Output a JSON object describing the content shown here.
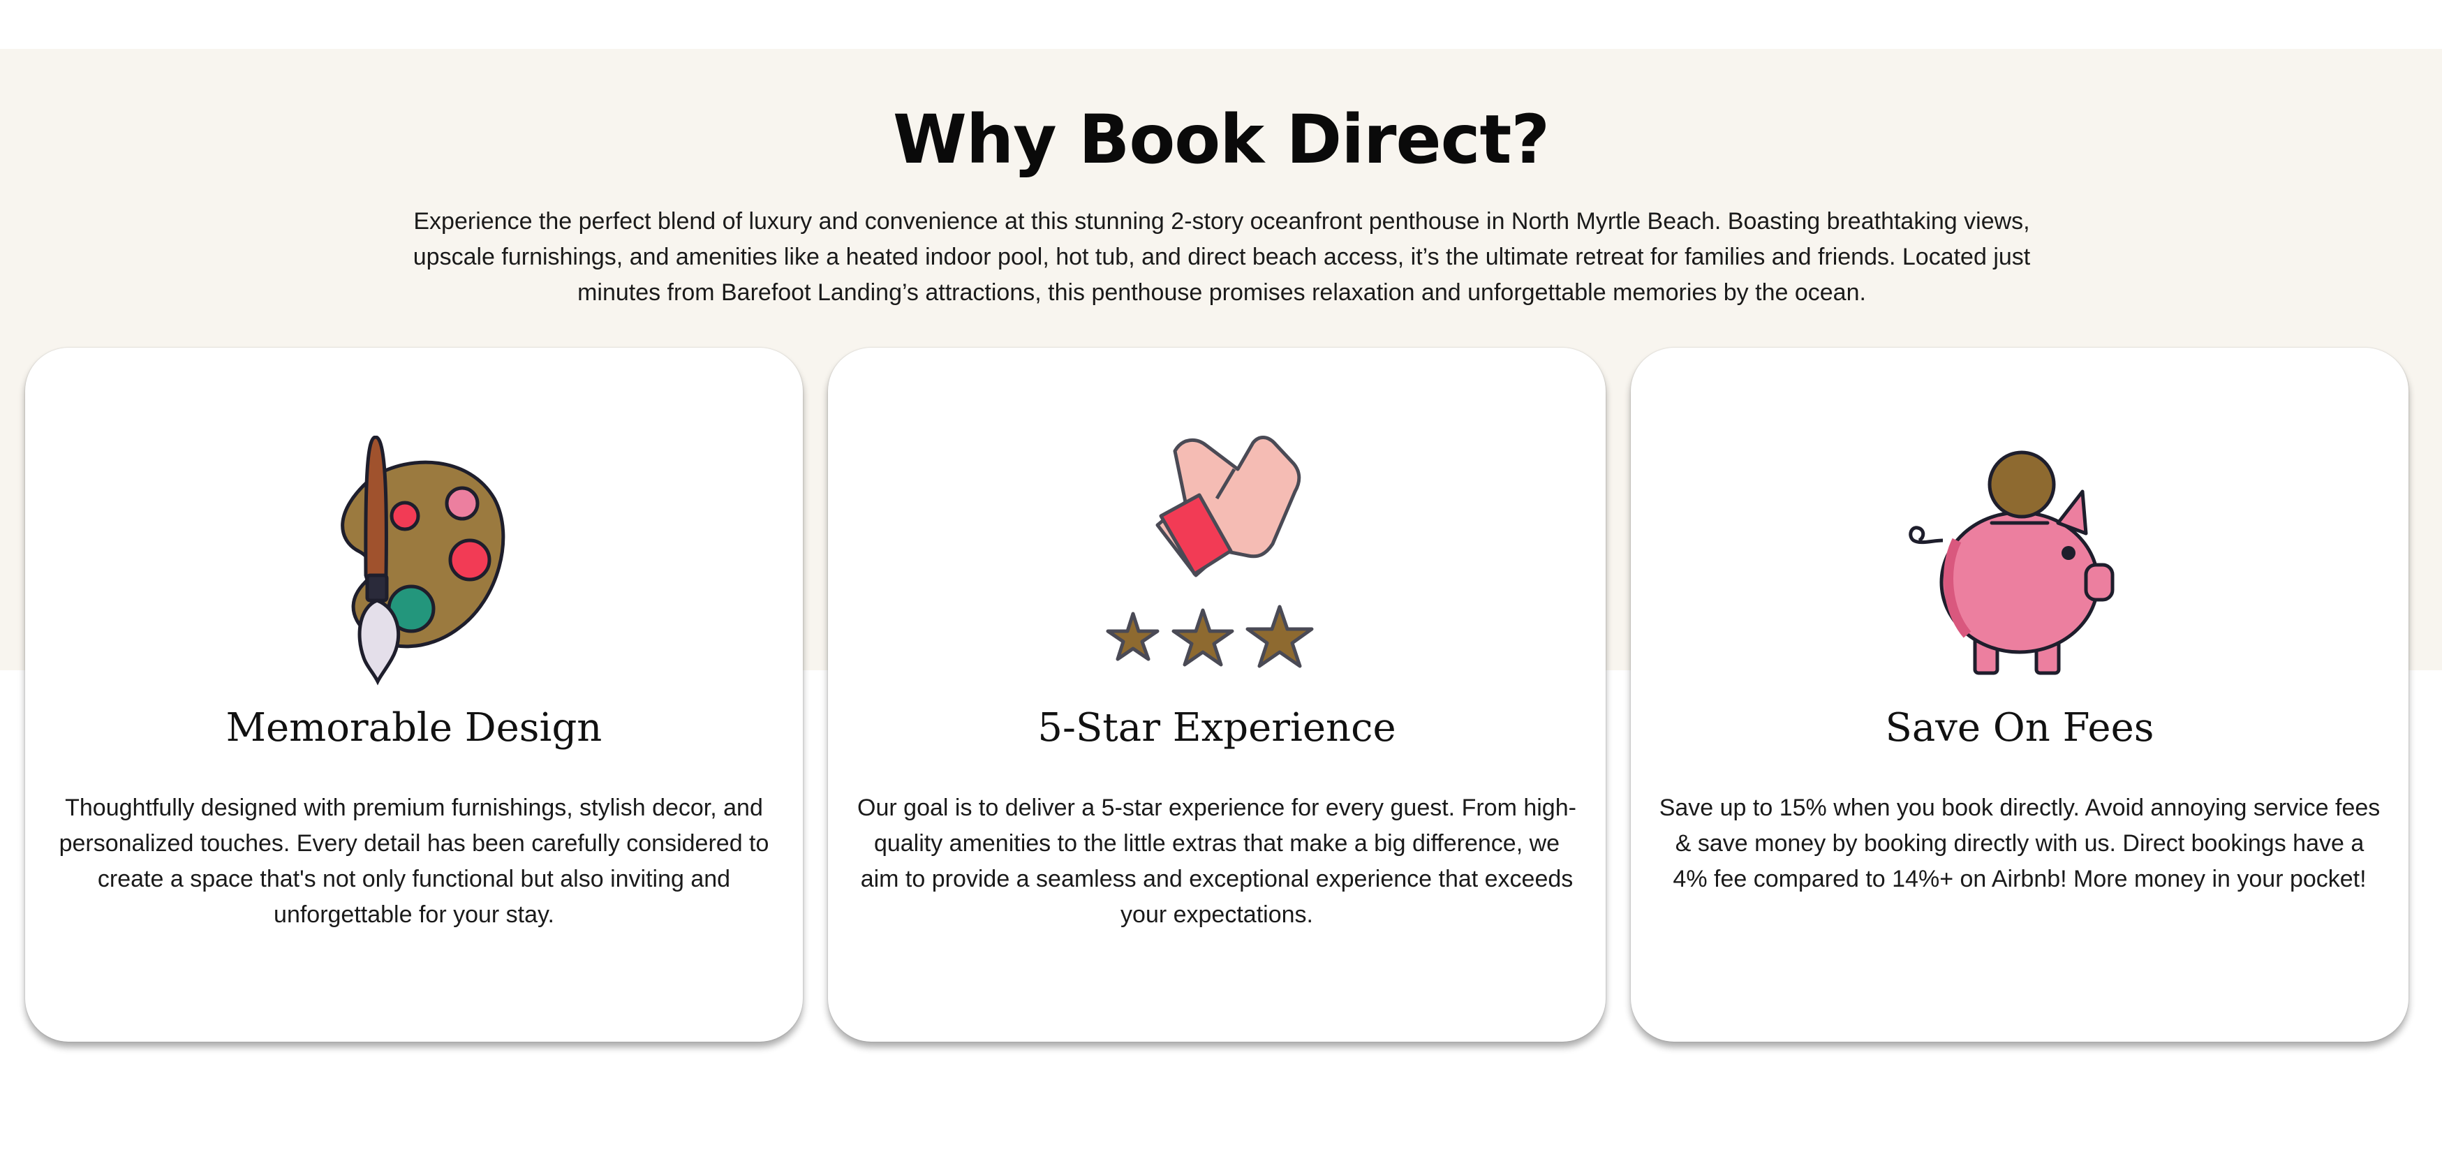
{
  "section": {
    "title": "Why Book Direct?",
    "intro": "Experience the perfect blend of luxury and convenience at this stunning 2-story oceanfront penthouse in North Myrtle Beach. Boasting breathtaking views, upscale furnishings, and amenities like a heated indoor pool, hot tub, and direct beach access, it’s the ultimate retreat for families and friends. Located just minutes from Barefoot Landing’s attractions, this penthouse promises relaxation and unforgettable memories by the ocean."
  },
  "cards": [
    {
      "icon": "palette-brush-icon",
      "title": "Memorable Design",
      "text": "Thoughtfully designed with premium furnishings, stylish decor, and personalized touches. Every detail has been carefully considered to create a space that's not only functional but also inviting and unforgettable for your stay."
    },
    {
      "icon": "thumbs-up-stars-icon",
      "title": "5-Star Experience",
      "text": "Our goal is to deliver a 5-star experience for every guest. From high-quality amenities to the little extras that make a big difference, we aim to provide a seamless and exceptional experience that exceeds your expectations."
    },
    {
      "icon": "piggy-bank-coin-icon",
      "title": "Save On Fees",
      "text": "Save up to 15% when you book directly. Avoid annoying service fees & save money by booking directly with us. Direct bookings have a 4% fee compared to 14%+ on Airbnb! More money in your pocket!"
    }
  ],
  "colors": {
    "band": "#f8f5ef",
    "card": "#ffffff",
    "bronze": "#9b7a3f",
    "pink": "#ec7f9f",
    "red": "#f23b55",
    "teal": "#23967c",
    "outline": "#1e1e2c"
  }
}
